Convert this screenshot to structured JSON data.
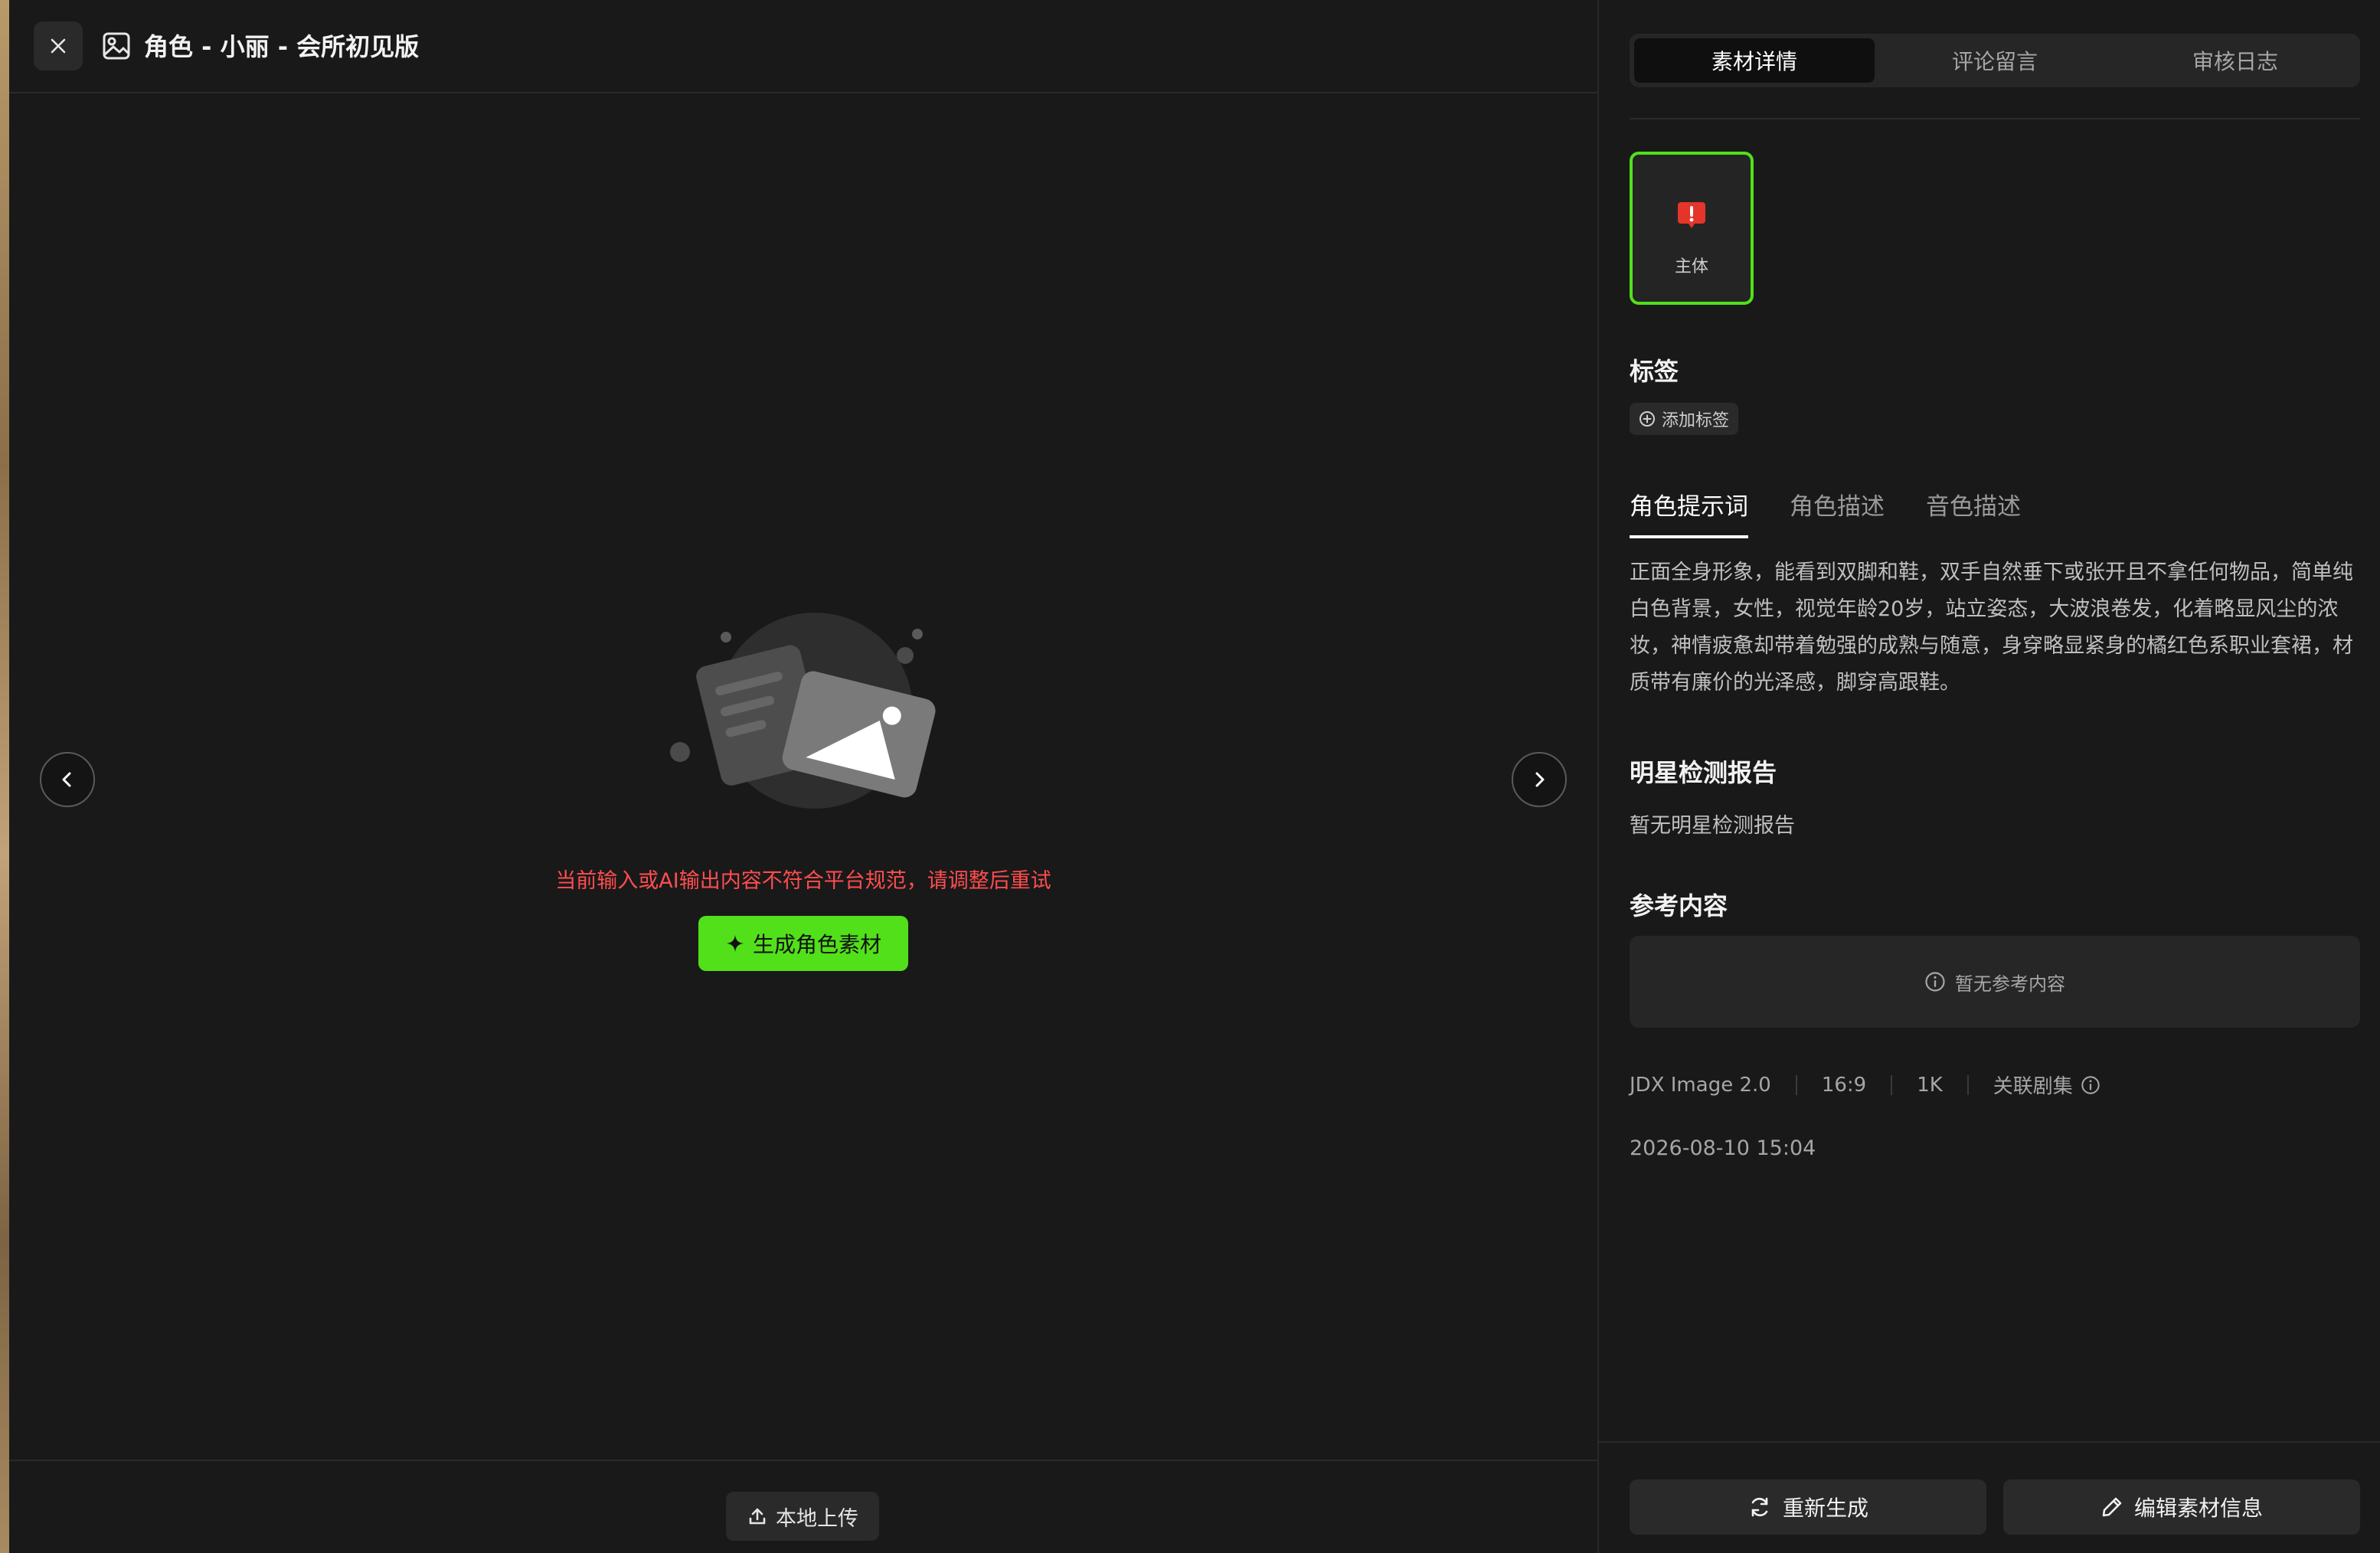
{
  "header": {
    "title": "角色 - 小丽 - 会所初见版"
  },
  "main": {
    "error_message": "当前输入或AI输出内容不符合平台规范，请调整后重试",
    "generate_label": "生成角色素材",
    "upload_label": "本地上传"
  },
  "panel": {
    "tabs": [
      "素材详情",
      "评论留言",
      "审核日志"
    ],
    "thumbnail_label": "主体",
    "tags_title": "标签",
    "add_tag_label": "添加标签",
    "sub_tabs": [
      "角色提示词",
      "角色描述",
      "音色描述"
    ],
    "description": "正面全身形象，能看到双脚和鞋，双手自然垂下或张开且不拿任何物品，简单纯白色背景，女性，视觉年龄20岁，站立姿态，大波浪卷发，化着略显风尘的浓妆，神情疲惫却带着勉强的成熟与随意，身穿略显紧身的橘红色系职业套裙，材质带有廉价的光泽感，脚穿高跟鞋。",
    "star_report_title": "明星检测报告",
    "star_report_empty": "暂无明星检测报告",
    "reference_title": "参考内容",
    "reference_empty": "暂无参考内容",
    "meta": {
      "model": "JDX Image 2.0",
      "ratio": "16:9",
      "resolution": "1K",
      "linked_label": "关联剧集"
    },
    "timestamp": "2026-08-10 15:04",
    "regenerate_label": "重新生成",
    "edit_label": "编辑素材信息"
  },
  "colors": {
    "accent_green": "#52e01a",
    "error_red": "#ff4d4f",
    "background": "#191919"
  }
}
